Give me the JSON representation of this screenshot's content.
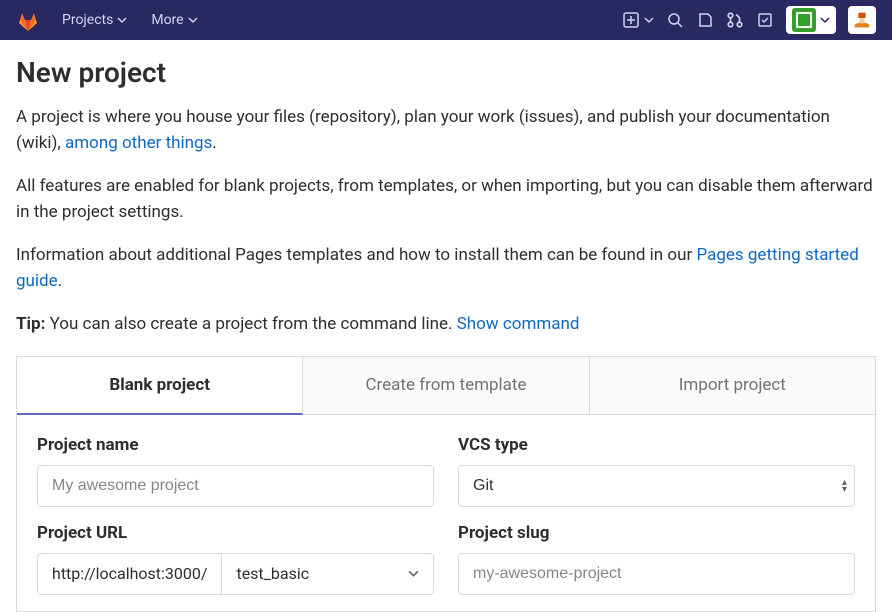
{
  "navbar": {
    "projects_label": "Projects",
    "more_label": "More"
  },
  "page": {
    "title": "New project",
    "intro_before_link": "A project is where you house your files (repository), plan your work (issues), and publish your documentation (wiki), ",
    "intro_link": "among other things",
    "intro_after_link": ".",
    "features_para": "All features are enabled for blank projects, from templates, or when importing, but you can disable them afterward in the project settings.",
    "pages_before_link": "Information about additional Pages templates and how to install them can be found in our ",
    "pages_link": "Pages getting started guide",
    "pages_after_link": ".",
    "tip_label": "Tip:",
    "tip_text": " You can also create a project from the command line. ",
    "tip_link": "Show command"
  },
  "tabs": {
    "blank": "Blank project",
    "template": "Create from template",
    "import": "Import project"
  },
  "form": {
    "project_name_label": "Project name",
    "project_name_placeholder": "My awesome project",
    "vcs_type_label": "VCS type",
    "vcs_type_value": "Git",
    "project_url_label": "Project URL",
    "project_url_prefix": "http://localhost:3000/",
    "project_url_namespace": "test_basic",
    "project_slug_label": "Project slug",
    "project_slug_placeholder": "my-awesome-project"
  }
}
